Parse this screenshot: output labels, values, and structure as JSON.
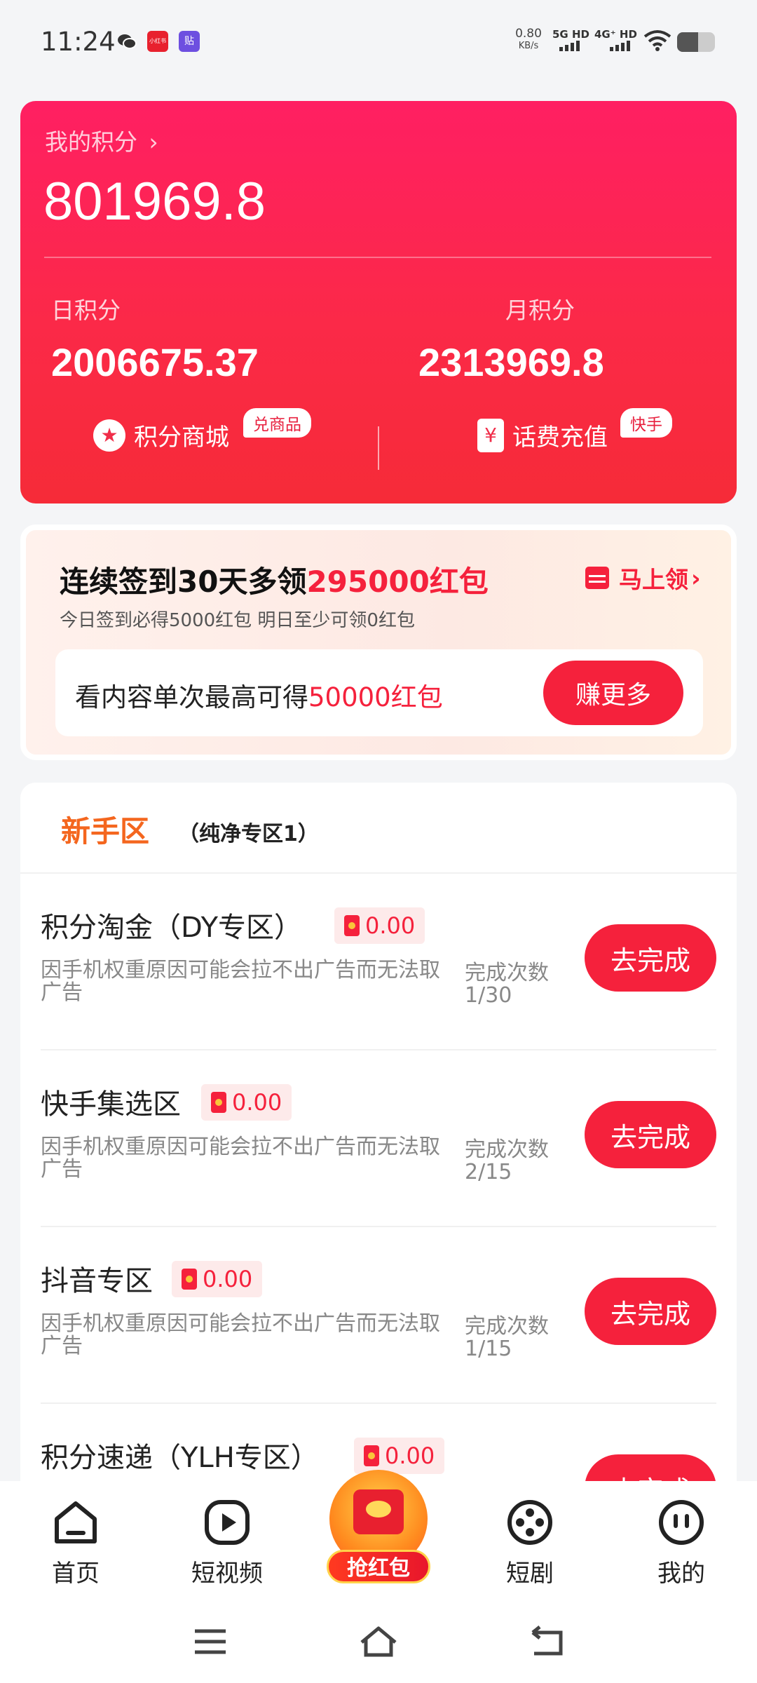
{
  "status_bar": {
    "time": "11:24",
    "app_icon_1_text": "小红书",
    "app_icon_2_text": "贴",
    "speed_value": "0.80",
    "speed_unit": "KB/s",
    "sim1": "5G HD",
    "sim2": "4G⁺ HD",
    "battery_level": 0.55
  },
  "points_card": {
    "label": "我的积分",
    "value": "801969.8",
    "daily_label": "日积分",
    "daily_value": "2006675.37",
    "monthly_label": "月积分",
    "monthly_value": "2313969.8",
    "mall_label": "积分商城",
    "mall_badge": "兑商品",
    "recharge_label": "话费充值",
    "recharge_badge": "快手"
  },
  "sign_in": {
    "title_prefix": "连续签到30天多领",
    "title_highlight": "295000红包",
    "subtitle": "今日签到必得5000红包 明日至少可领0红包",
    "claim_label": "马上领",
    "content_prefix": "看内容单次最高可得",
    "content_highlight": "50000红包",
    "earn_button": "赚更多"
  },
  "tasks": {
    "section_title": "新手区",
    "section_subtitle": "（纯净专区1）",
    "button_label": "去完成",
    "count_label": "完成次数",
    "items": [
      {
        "name": "积分淘金（DY专区）",
        "reward": "0.00",
        "desc": "因手机权重原因可能会拉不出广告而无法取广告",
        "count": "1/30"
      },
      {
        "name": "快手集选区",
        "reward": "0.00",
        "desc": "因手机权重原因可能会拉不出广告而无法取广告",
        "count": "2/15"
      },
      {
        "name": "抖音专区",
        "reward": "0.00",
        "desc": "因手机权重原因可能会拉不出广告而无法取广告",
        "count": "1/15"
      },
      {
        "name": "积分速递（YLH专区）",
        "reward": "0.00",
        "desc": "",
        "count": ""
      }
    ]
  },
  "bottom_nav": {
    "home": "首页",
    "short_video": "短视频",
    "center": "抢红包",
    "drama": "短剧",
    "mine": "我的"
  },
  "colors": {
    "brand_red": "#f5213c",
    "card_gradient_top": "#ff1f62",
    "section_orange": "#f4661e"
  }
}
